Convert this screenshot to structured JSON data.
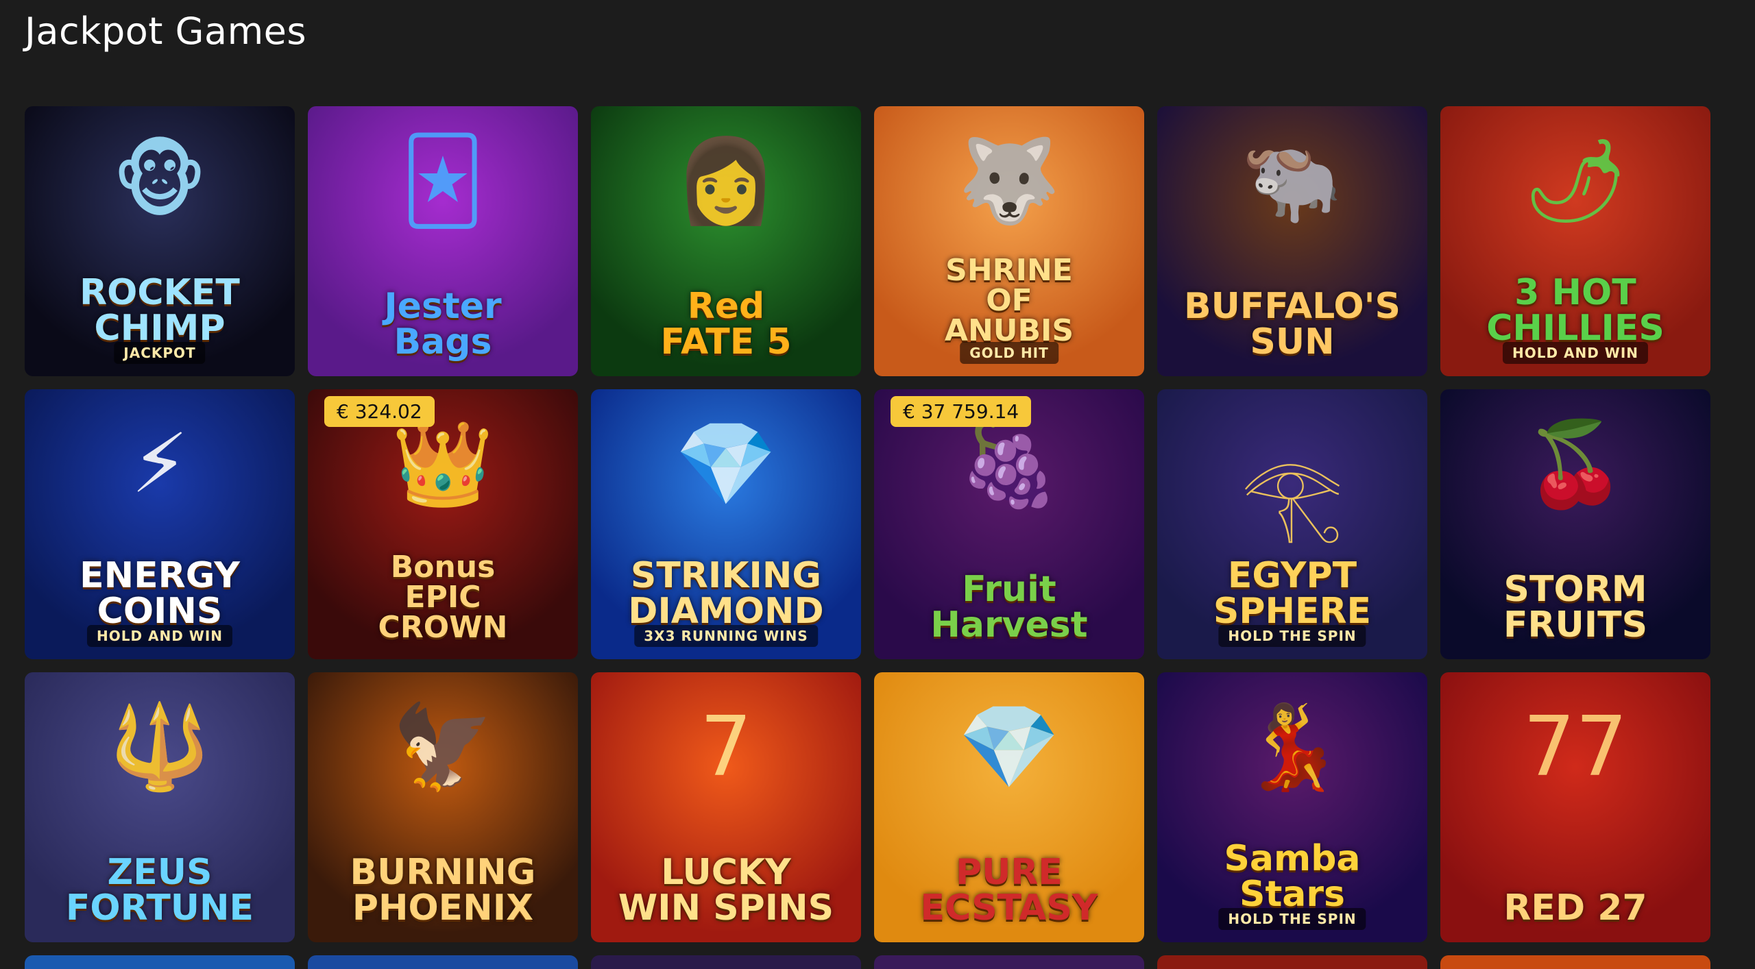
{
  "header": {
    "title": "Jackpot Games"
  },
  "games": [
    {
      "title": "ROCKET\nCHIMP",
      "subtitle": "JACKPOT",
      "colors": [
        "#0a0a18",
        "#2a2f5a"
      ],
      "accent": "#9ee3ff",
      "icon": "astronaut-chimp-icon",
      "glyph": "🐵",
      "badge": null
    },
    {
      "title": "Jester\nBags",
      "subtitle": "",
      "colors": [
        "#5a1a8a",
        "#a52ccf"
      ],
      "accent": "#4aa8ff",
      "icon": "jester-icon",
      "glyph": "🃏",
      "badge": null
    },
    {
      "title": "Red\nFATE 5",
      "subtitle": "",
      "colors": [
        "#0c3a10",
        "#2c8f2e"
      ],
      "accent": "#ffb11a",
      "icon": "fortune-woman-icon",
      "glyph": "👩",
      "badge": null
    },
    {
      "title": "SHRINE\nOF\nANUBIS",
      "subtitle": "GOLD HIT",
      "colors": [
        "#c85a1a",
        "#f4a04a"
      ],
      "accent": "#ffe08a",
      "icon": "anubis-icon",
      "glyph": "🐺",
      "badge": null
    },
    {
      "title": "BUFFALO'S\nSUN",
      "subtitle": "",
      "colors": [
        "#1a0f3a",
        "#6a3a1a"
      ],
      "accent": "#ffc864",
      "icon": "buffalo-icon",
      "glyph": "🐃",
      "badge": null
    },
    {
      "title": "3 HOT\nCHILLIES",
      "subtitle": "HOLD AND WIN",
      "colors": [
        "#8a1a10",
        "#d03a20"
      ],
      "accent": "#5ad04a",
      "icon": "chili-pepper-icon",
      "glyph": "🌶",
      "badge": null
    },
    {
      "title": "ENERGY COINS",
      "subtitle": "HOLD AND WIN",
      "colors": [
        "#0a1a5a",
        "#1a3aaa"
      ],
      "accent": "#ffffff",
      "icon": "lightning-coin-icon",
      "glyph": "⚡",
      "badge": null
    },
    {
      "title": "Bonus\nEPIC\nCROWN",
      "subtitle": "",
      "colors": [
        "#3a0a0a",
        "#9a1a14"
      ],
      "accent": "#ffd27a",
      "icon": "crown-icon",
      "glyph": "👑",
      "badge": "€ 324.02"
    },
    {
      "title": "STRIKING\nDIAMOND",
      "subtitle": "3X3 RUNNING WINS",
      "colors": [
        "#0a2a8a",
        "#2a7ae0"
      ],
      "accent": "#ffe08a",
      "icon": "diamond-icon",
      "glyph": "💎",
      "badge": null
    },
    {
      "title": "Fruit\nHarvest",
      "subtitle": "",
      "colors": [
        "#2a0a4a",
        "#5a1a6a"
      ],
      "accent": "#7ad04a",
      "icon": "fruit-basket-icon",
      "glyph": "🍇",
      "badge": "€ 37 759.14"
    },
    {
      "title": "EGYPT\nSPHERE",
      "subtitle": "HOLD THE SPIN",
      "colors": [
        "#1a1a4a",
        "#3a2a7a"
      ],
      "accent": "#ffd25a",
      "icon": "pharaoh-icon",
      "glyph": "𓂀",
      "badge": null
    },
    {
      "title": "STORM\nFRUITS",
      "subtitle": "",
      "colors": [
        "#0a0a2a",
        "#3a1a5a"
      ],
      "accent": "#ffe08a",
      "icon": "fruit-crown-icon",
      "glyph": "🍒",
      "badge": null
    },
    {
      "title": "ZEUS\nFORTUNE",
      "subtitle": "",
      "colors": [
        "#2a2a5a",
        "#4a4a8a"
      ],
      "accent": "#6ad4ff",
      "icon": "zeus-icon",
      "glyph": "🔱",
      "badge": null
    },
    {
      "title": "BURNING\nPHOENIX",
      "subtitle": "",
      "colors": [
        "#3a1a0a",
        "#c05a10"
      ],
      "accent": "#ffd27a",
      "icon": "phoenix-icon",
      "glyph": "🦅",
      "badge": null
    },
    {
      "title": "LUCKY\nWIN SPINS",
      "subtitle": "",
      "colors": [
        "#a01a10",
        "#f05a1a"
      ],
      "accent": "#ffe08a",
      "icon": "lucky-seven-icon",
      "glyph": "7",
      "badge": null
    },
    {
      "title": "PURE ECSTASY",
      "subtitle": "",
      "colors": [
        "#e08a10",
        "#f4b03a"
      ],
      "accent": "#d02a2a",
      "icon": "twin-diamonds-icon",
      "glyph": "💎",
      "badge": null
    },
    {
      "title": "Samba\nStars",
      "subtitle": "HOLD THE SPIN",
      "colors": [
        "#1a0a4a",
        "#5a1a6a"
      ],
      "accent": "#ffd23a",
      "icon": "samba-dancer-icon",
      "glyph": "💃",
      "badge": null
    },
    {
      "title": "RED 27",
      "subtitle": "",
      "colors": [
        "#8a1010",
        "#d02a1a"
      ],
      "accent": "#ffd27a",
      "icon": "sevens-slot-icon",
      "glyph": "77",
      "badge": null
    }
  ],
  "partial_row_colors": [
    "#1a5ab0",
    "#1a4aa0",
    "#2a1a4a",
    "#3a1a5a",
    "#8a1a10",
    "#c84a10"
  ]
}
